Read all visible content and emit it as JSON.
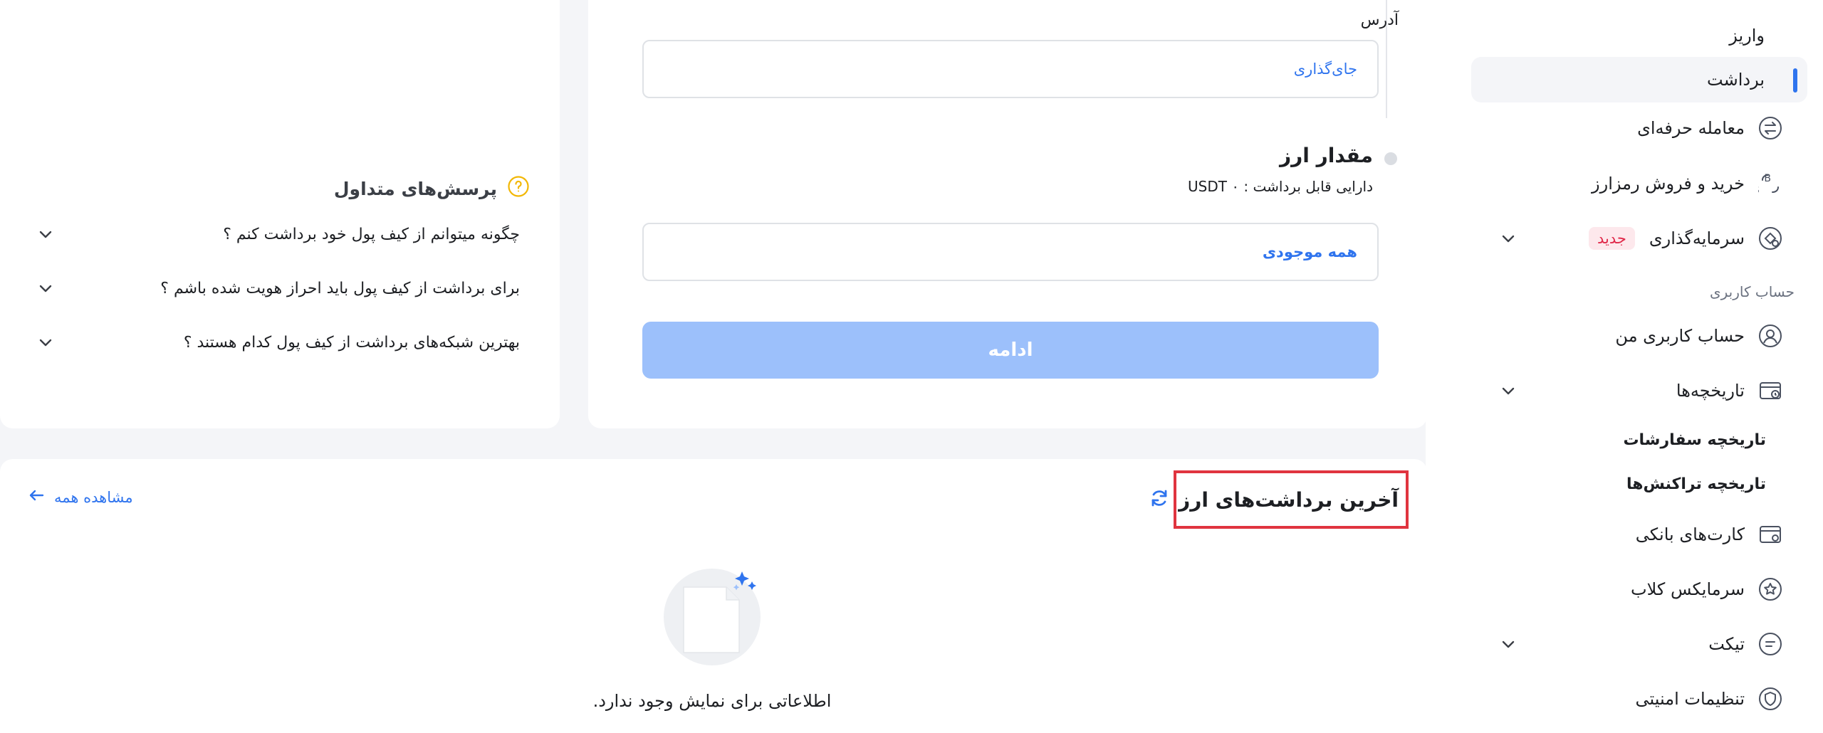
{
  "sidebar": {
    "items": {
      "deposit": "واریز",
      "withdraw": "برداشت",
      "pro_trade": "معامله حرفه‌ای",
      "buy_sell": "خرید و فروش رمزارز",
      "investment": "سرمایه‌گذاری",
      "investment_badge": "جدید",
      "my_account": "حساب کاربری من",
      "histories": "تاریخچه‌ها",
      "order_history": "تاریخچه سفارشات",
      "transaction_history": "تاریخچه تراکنش‌ها",
      "bank_cards": "کارت‌های بانکی",
      "club": "سرمایکس کلاب",
      "ticket": "تیکت",
      "security": "تنظیمات امنیتی"
    },
    "section_account": "حساب کاربری"
  },
  "form": {
    "address_label": "آدرس",
    "address_value": "جای‌گذاری",
    "amount_title": "مقدار ارز",
    "balance_text": "دارایی قابل برداشت : ۰ USDT",
    "amount_value": "همه موجودی",
    "submit_label": "ادامه"
  },
  "faq": {
    "title": "پرسش‌های متداول",
    "questions": [
      "چگونه میتوانم از کیف پول خود برداشت کنم ؟",
      "برای برداشت از کیف پول باید احراز هویت شده باشم ؟",
      "بهترین شبکه‌های برداشت از کیف پول کدام هستند ؟"
    ]
  },
  "history": {
    "title": "آخرین برداشت‌های ارز",
    "see_all": "مشاهده همه",
    "empty_text": "اطلاعاتی برای نمایش وجود ندارد."
  },
  "colors": {
    "accent": "#2f74ee",
    "button_disabled": "#9cc0fb",
    "badge_text": "#e0294a",
    "badge_bg": "#fde8ec",
    "highlight_border": "#e0343f",
    "faq_icon": "#f2b705"
  }
}
